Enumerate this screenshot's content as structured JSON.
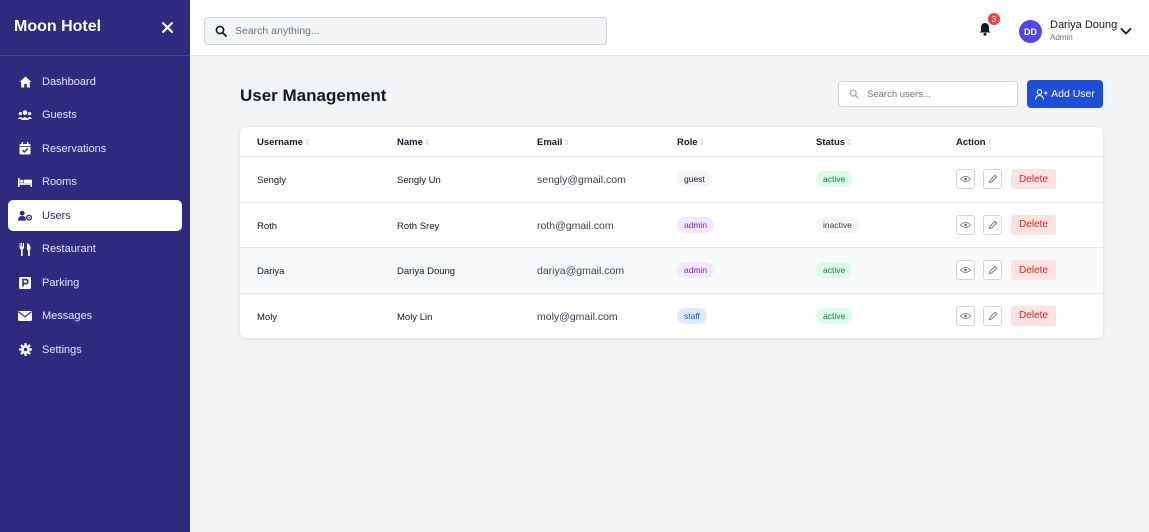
{
  "sidebar": {
    "brand": "Moon Hotel",
    "items": [
      {
        "label": "Dashboard",
        "icon": "home-icon"
      },
      {
        "label": "Guests",
        "icon": "users-group-icon"
      },
      {
        "label": "Reservations",
        "icon": "calendar-check-icon"
      },
      {
        "label": "Rooms",
        "icon": "bed-icon"
      },
      {
        "label": "Users",
        "icon": "user-cog-icon",
        "active": true
      },
      {
        "label": "Restaurant",
        "icon": "utensils-icon"
      },
      {
        "label": "Parking",
        "icon": "parking-icon"
      },
      {
        "label": "Messages",
        "icon": "envelope-icon"
      },
      {
        "label": "Settings",
        "icon": "gear-icon"
      }
    ]
  },
  "topbar": {
    "search_placeholder": "Search anything...",
    "notification_count": "3",
    "user": {
      "initials": "DD",
      "name": "Dariya Doung",
      "role": "Admin"
    }
  },
  "main": {
    "title": "User Management",
    "search_placeholder": "Search users...",
    "add_label": "Add User",
    "columns": [
      "Username",
      "Name",
      "Email",
      "Role",
      "Status",
      "Action"
    ],
    "delete_label": "Delete",
    "rows": [
      {
        "username": "Sengly",
        "name": "Sengly Un",
        "email": "sengly@gmail.com",
        "role": "guest",
        "status": "active"
      },
      {
        "username": "Roth",
        "name": "Roth Srey",
        "email": "roth@gmail.com",
        "role": "admin",
        "status": "inactive"
      },
      {
        "username": "Dariya",
        "name": "Dariya Doung",
        "email": "dariya@gmail.com",
        "role": "admin",
        "status": "active"
      },
      {
        "username": "Moly",
        "name": "Moly Lin",
        "email": "moly@gmail.com",
        "role": "staff",
        "status": "active"
      }
    ]
  },
  "colors": {
    "sidebar_bg": "#2e2a7e",
    "primary": "#1d4ed8",
    "avatar": "#4f46e5",
    "danger": "#dc2626",
    "badge": "#ef4444"
  }
}
